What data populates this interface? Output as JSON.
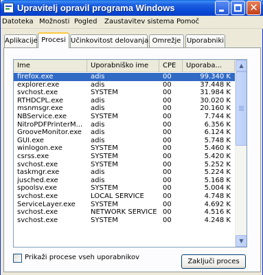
{
  "window": {
    "title": "Upravitelj opravil programa Windows"
  },
  "colors": {
    "titlebar": "#0a4ad6",
    "selection": "#316ac5",
    "active_tab_accent": "#ffc83c"
  },
  "menu": [
    "Datoteka",
    "Možnosti",
    "Pogled",
    "Zaustavitev sistema",
    "Pomoč"
  ],
  "tabs": [
    {
      "label": "Aplikacije",
      "active": false
    },
    {
      "label": "Procesi",
      "active": true
    },
    {
      "label": "Učinkovitost delovanja",
      "active": false
    },
    {
      "label": "Omrežje",
      "active": false
    },
    {
      "label": "Uporabniki",
      "active": false
    }
  ],
  "table": {
    "columns": [
      "Ime",
      "Uporabniško ime",
      "CPE",
      "Uporaba..."
    ],
    "selected_row": 0,
    "rows": [
      [
        "firefox.exe",
        "adis",
        "00",
        "99.340 K"
      ],
      [
        "explorer.exe",
        "adis",
        "00",
        "37.448 K"
      ],
      [
        "svchost.exe",
        "SYSTEM",
        "00",
        "31.984 K"
      ],
      [
        "RTHDCPL.exe",
        "adis",
        "00",
        "30.020 K"
      ],
      [
        "msnmsgr.exe",
        "adis",
        "00",
        "20.160 K"
      ],
      [
        "NBService.exe",
        "SYSTEM",
        "00",
        "7.744 K"
      ],
      [
        "NitroPDFPrinterM...",
        "adis",
        "00",
        "6.356 K"
      ],
      [
        "GrooveMonitor.exe",
        "adis",
        "00",
        "6.124 K"
      ],
      [
        "GUI.exe",
        "adis",
        "00",
        "5.748 K"
      ],
      [
        "winlogon.exe",
        "SYSTEM",
        "00",
        "5.460 K"
      ],
      [
        "csrss.exe",
        "SYSTEM",
        "00",
        "5.420 K"
      ],
      [
        "svchost.exe",
        "SYSTEM",
        "00",
        "5.252 K"
      ],
      [
        "taskmgr.exe",
        "adis",
        "00",
        "5.224 K"
      ],
      [
        "jusched.exe",
        "adis",
        "00",
        "5.168 K"
      ],
      [
        "spoolsv.exe",
        "SYSTEM",
        "00",
        "5.004 K"
      ],
      [
        "svchost.exe",
        "LOCAL SERVICE",
        "00",
        "4.748 K"
      ],
      [
        "ServiceLayer.exe",
        "SYSTEM",
        "00",
        "4.692 K"
      ],
      [
        "svchost.exe",
        "NETWORK SERVICE",
        "00",
        "4.516 K"
      ],
      [
        "svchost.exe",
        "SYSTEM",
        "00",
        "4.248 K"
      ]
    ]
  },
  "footer": {
    "show_all_label": "Prikaži procese vseh uporabnikov",
    "show_all_checked": false,
    "end_process_label": "Zaključi proces"
  }
}
